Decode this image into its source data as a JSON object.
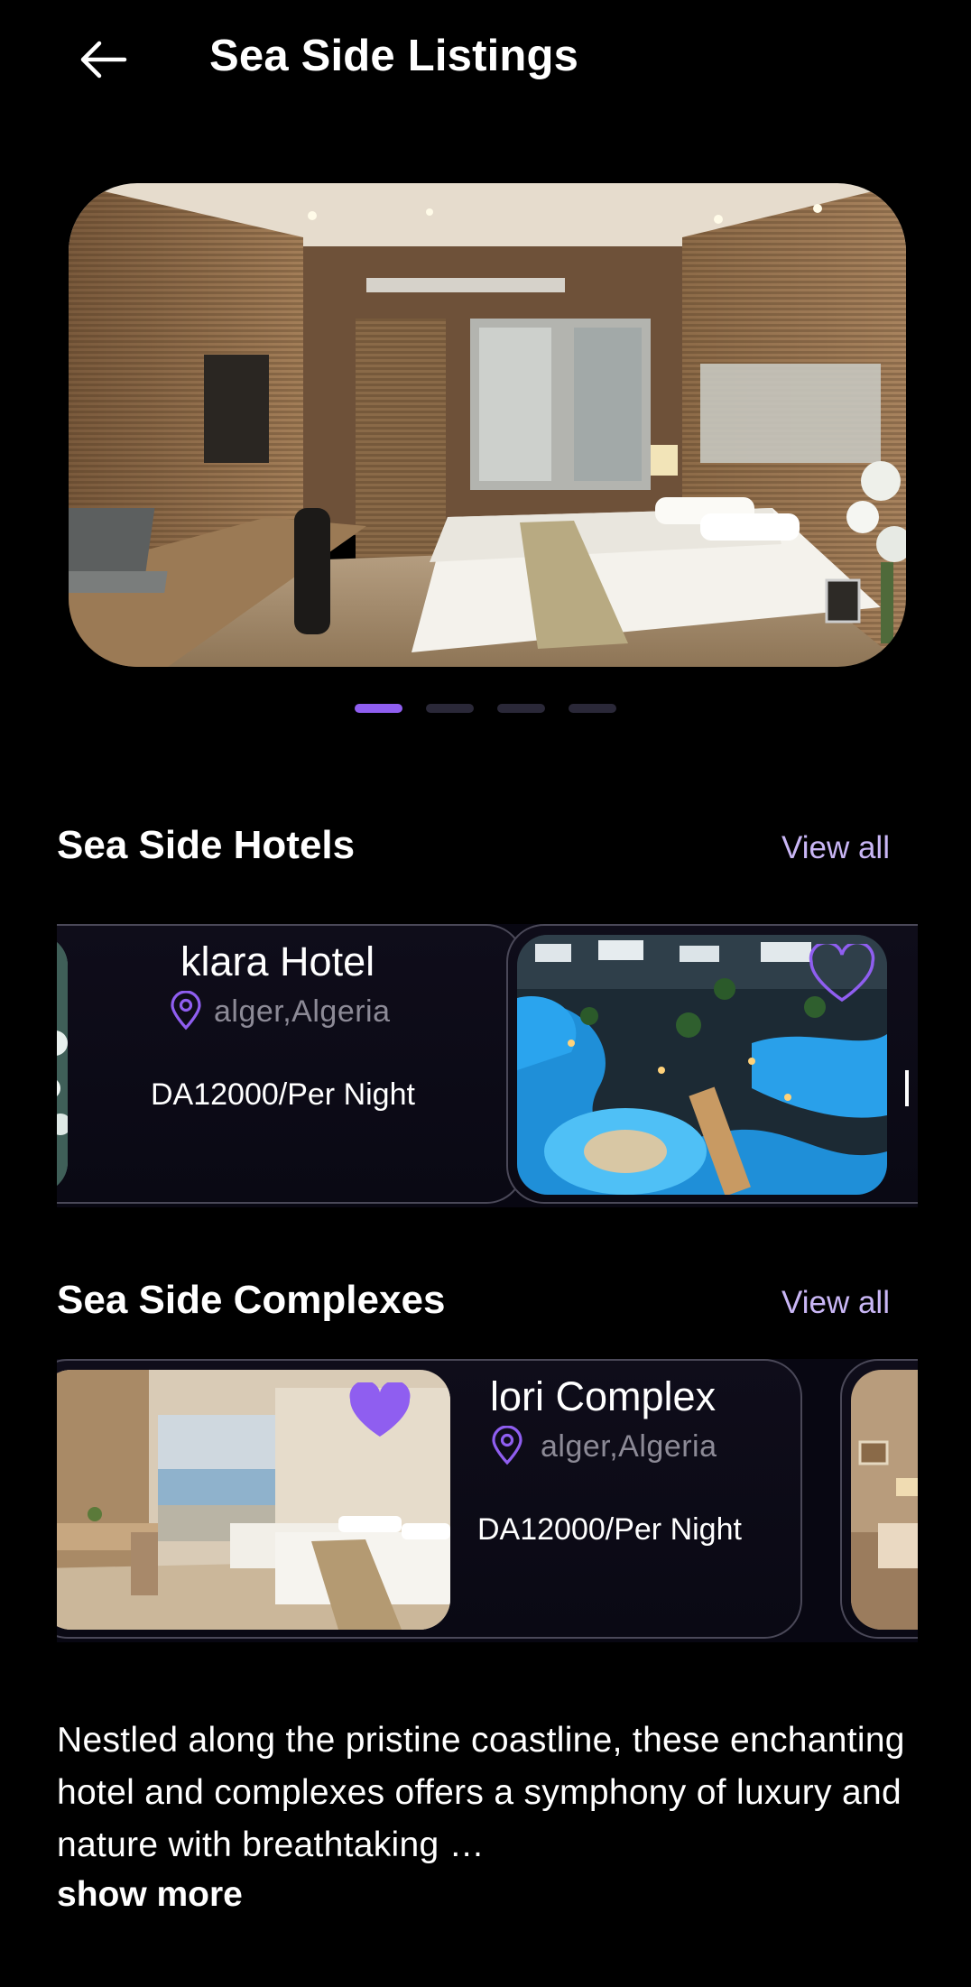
{
  "header": {
    "title": "Sea Side Listings",
    "back_icon": "arrow-left-icon"
  },
  "carousel": {
    "image": "hotel-room-photo",
    "slide_count": 4,
    "active_index": 0,
    "accent_color": "#8f5ef0"
  },
  "hotels": {
    "title": "Sea Side Hotels",
    "view_all": "View all",
    "cards": [
      {
        "name": "klara Hotel",
        "location": "alger,Algeria",
        "price": "DA12000/Per Night",
        "image": "hotel-photo"
      },
      {
        "image": "resort-pool-night-photo",
        "favorite": false
      }
    ]
  },
  "complexes": {
    "title": "Sea Side Complexes",
    "view_all": "View all",
    "cards": [
      {
        "name": "lori Complex",
        "location": "alger,Algeria",
        "price": "DA12000/Per Night",
        "image": "seaview-room-photo",
        "favorite": true
      },
      {
        "image": "bedroom-photo"
      }
    ]
  },
  "description": {
    "text": "Nestled along the pristine coastline, these enchanting hotel and complexes offers a symphony of luxury and nature with breathtaking …",
    "show_more": "show more"
  },
  "colors": {
    "background": "#000000",
    "accent": "#8f5ef0",
    "link": "#c9b6f5",
    "muted_text": "#8c8a96"
  }
}
